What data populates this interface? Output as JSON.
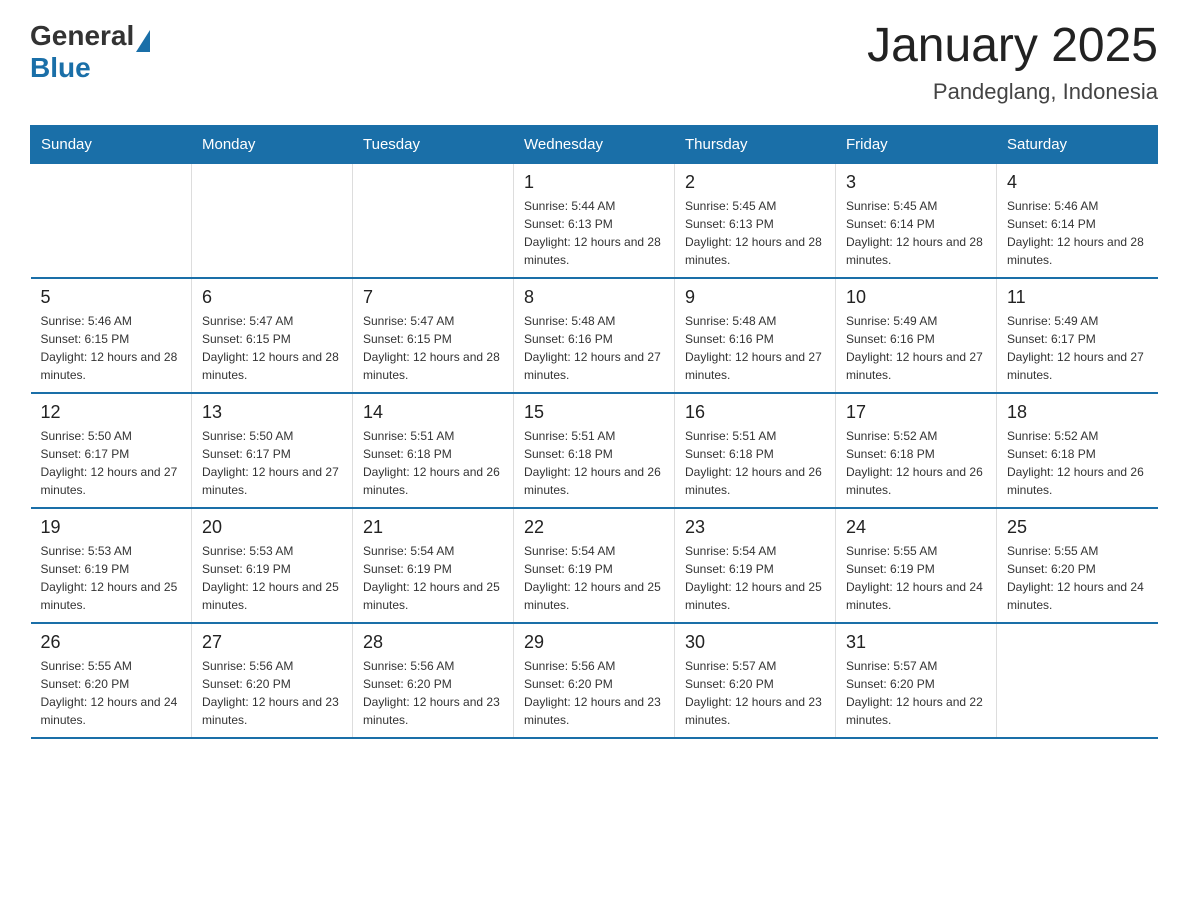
{
  "header": {
    "logo_general": "General",
    "logo_blue": "Blue",
    "month_title": "January 2025",
    "location": "Pandeglang, Indonesia"
  },
  "days_of_week": [
    "Sunday",
    "Monday",
    "Tuesday",
    "Wednesday",
    "Thursday",
    "Friday",
    "Saturday"
  ],
  "weeks": [
    [
      {
        "day": "",
        "info": ""
      },
      {
        "day": "",
        "info": ""
      },
      {
        "day": "",
        "info": ""
      },
      {
        "day": "1",
        "info": "Sunrise: 5:44 AM\nSunset: 6:13 PM\nDaylight: 12 hours and 28 minutes."
      },
      {
        "day": "2",
        "info": "Sunrise: 5:45 AM\nSunset: 6:13 PM\nDaylight: 12 hours and 28 minutes."
      },
      {
        "day": "3",
        "info": "Sunrise: 5:45 AM\nSunset: 6:14 PM\nDaylight: 12 hours and 28 minutes."
      },
      {
        "day": "4",
        "info": "Sunrise: 5:46 AM\nSunset: 6:14 PM\nDaylight: 12 hours and 28 minutes."
      }
    ],
    [
      {
        "day": "5",
        "info": "Sunrise: 5:46 AM\nSunset: 6:15 PM\nDaylight: 12 hours and 28 minutes."
      },
      {
        "day": "6",
        "info": "Sunrise: 5:47 AM\nSunset: 6:15 PM\nDaylight: 12 hours and 28 minutes."
      },
      {
        "day": "7",
        "info": "Sunrise: 5:47 AM\nSunset: 6:15 PM\nDaylight: 12 hours and 28 minutes."
      },
      {
        "day": "8",
        "info": "Sunrise: 5:48 AM\nSunset: 6:16 PM\nDaylight: 12 hours and 27 minutes."
      },
      {
        "day": "9",
        "info": "Sunrise: 5:48 AM\nSunset: 6:16 PM\nDaylight: 12 hours and 27 minutes."
      },
      {
        "day": "10",
        "info": "Sunrise: 5:49 AM\nSunset: 6:16 PM\nDaylight: 12 hours and 27 minutes."
      },
      {
        "day": "11",
        "info": "Sunrise: 5:49 AM\nSunset: 6:17 PM\nDaylight: 12 hours and 27 minutes."
      }
    ],
    [
      {
        "day": "12",
        "info": "Sunrise: 5:50 AM\nSunset: 6:17 PM\nDaylight: 12 hours and 27 minutes."
      },
      {
        "day": "13",
        "info": "Sunrise: 5:50 AM\nSunset: 6:17 PM\nDaylight: 12 hours and 27 minutes."
      },
      {
        "day": "14",
        "info": "Sunrise: 5:51 AM\nSunset: 6:18 PM\nDaylight: 12 hours and 26 minutes."
      },
      {
        "day": "15",
        "info": "Sunrise: 5:51 AM\nSunset: 6:18 PM\nDaylight: 12 hours and 26 minutes."
      },
      {
        "day": "16",
        "info": "Sunrise: 5:51 AM\nSunset: 6:18 PM\nDaylight: 12 hours and 26 minutes."
      },
      {
        "day": "17",
        "info": "Sunrise: 5:52 AM\nSunset: 6:18 PM\nDaylight: 12 hours and 26 minutes."
      },
      {
        "day": "18",
        "info": "Sunrise: 5:52 AM\nSunset: 6:18 PM\nDaylight: 12 hours and 26 minutes."
      }
    ],
    [
      {
        "day": "19",
        "info": "Sunrise: 5:53 AM\nSunset: 6:19 PM\nDaylight: 12 hours and 25 minutes."
      },
      {
        "day": "20",
        "info": "Sunrise: 5:53 AM\nSunset: 6:19 PM\nDaylight: 12 hours and 25 minutes."
      },
      {
        "day": "21",
        "info": "Sunrise: 5:54 AM\nSunset: 6:19 PM\nDaylight: 12 hours and 25 minutes."
      },
      {
        "day": "22",
        "info": "Sunrise: 5:54 AM\nSunset: 6:19 PM\nDaylight: 12 hours and 25 minutes."
      },
      {
        "day": "23",
        "info": "Sunrise: 5:54 AM\nSunset: 6:19 PM\nDaylight: 12 hours and 25 minutes."
      },
      {
        "day": "24",
        "info": "Sunrise: 5:55 AM\nSunset: 6:19 PM\nDaylight: 12 hours and 24 minutes."
      },
      {
        "day": "25",
        "info": "Sunrise: 5:55 AM\nSunset: 6:20 PM\nDaylight: 12 hours and 24 minutes."
      }
    ],
    [
      {
        "day": "26",
        "info": "Sunrise: 5:55 AM\nSunset: 6:20 PM\nDaylight: 12 hours and 24 minutes."
      },
      {
        "day": "27",
        "info": "Sunrise: 5:56 AM\nSunset: 6:20 PM\nDaylight: 12 hours and 23 minutes."
      },
      {
        "day": "28",
        "info": "Sunrise: 5:56 AM\nSunset: 6:20 PM\nDaylight: 12 hours and 23 minutes."
      },
      {
        "day": "29",
        "info": "Sunrise: 5:56 AM\nSunset: 6:20 PM\nDaylight: 12 hours and 23 minutes."
      },
      {
        "day": "30",
        "info": "Sunrise: 5:57 AM\nSunset: 6:20 PM\nDaylight: 12 hours and 23 minutes."
      },
      {
        "day": "31",
        "info": "Sunrise: 5:57 AM\nSunset: 6:20 PM\nDaylight: 12 hours and 22 minutes."
      },
      {
        "day": "",
        "info": ""
      }
    ]
  ]
}
